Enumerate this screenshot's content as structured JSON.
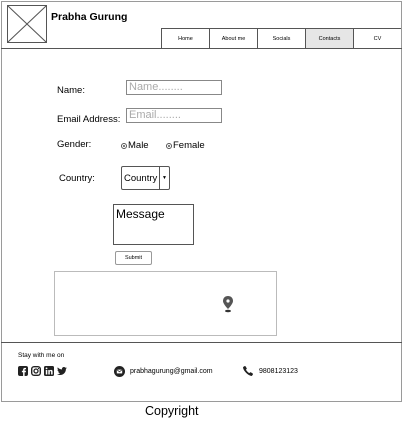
{
  "header": {
    "site_name": "Prabha Gurung",
    "nav": [
      {
        "label": "Home"
      },
      {
        "label": "About me"
      },
      {
        "label": "Socials"
      },
      {
        "label": "Contacts",
        "active": true
      },
      {
        "label": "CV"
      }
    ]
  },
  "form": {
    "name_label": "Name:",
    "name_placeholder": "Name........",
    "email_label": "Email Address:",
    "email_placeholder": "Email........",
    "gender_label": "Gender:",
    "gender_options": [
      "Male",
      "Female"
    ],
    "country_label": "Country:",
    "country_value": "Country",
    "message_placeholder": "Message",
    "submit_label": "Submit"
  },
  "footer": {
    "stay_text": "Stay with me on",
    "socials": [
      "facebook-icon",
      "instagram-icon",
      "linkedin-icon",
      "twitter-icon"
    ],
    "email": "prabhagurung@gmail.com",
    "phone": "9808123123",
    "copyright": "Copyright"
  }
}
